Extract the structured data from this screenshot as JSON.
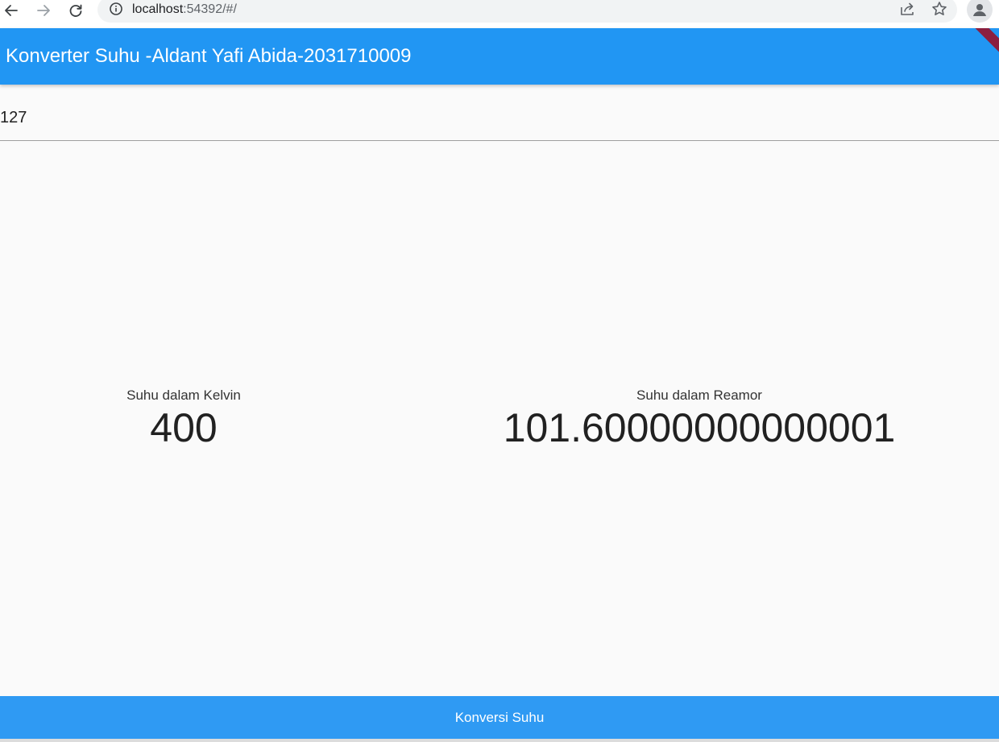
{
  "browser": {
    "url_host": "localhost",
    "url_rest": ":54392/#/",
    "icons": [
      "back-arrow-icon",
      "forward-arrow-icon",
      "reload-icon",
      "site-info-icon",
      "share-icon",
      "star-icon",
      "profile-icon"
    ]
  },
  "app_bar": {
    "title": "Konverter Suhu -Aldant Yafi Abida-2031710009",
    "color": "#2196f3"
  },
  "input": {
    "value": "127"
  },
  "results": {
    "kelvin_label": "Suhu dalam Kelvin",
    "kelvin_value": "400",
    "reamur_label": "Suhu dalam Reamor",
    "reamur_value": "101.60000000000001"
  },
  "button": {
    "label": "Konversi Suhu",
    "color": "#2f9af3"
  }
}
